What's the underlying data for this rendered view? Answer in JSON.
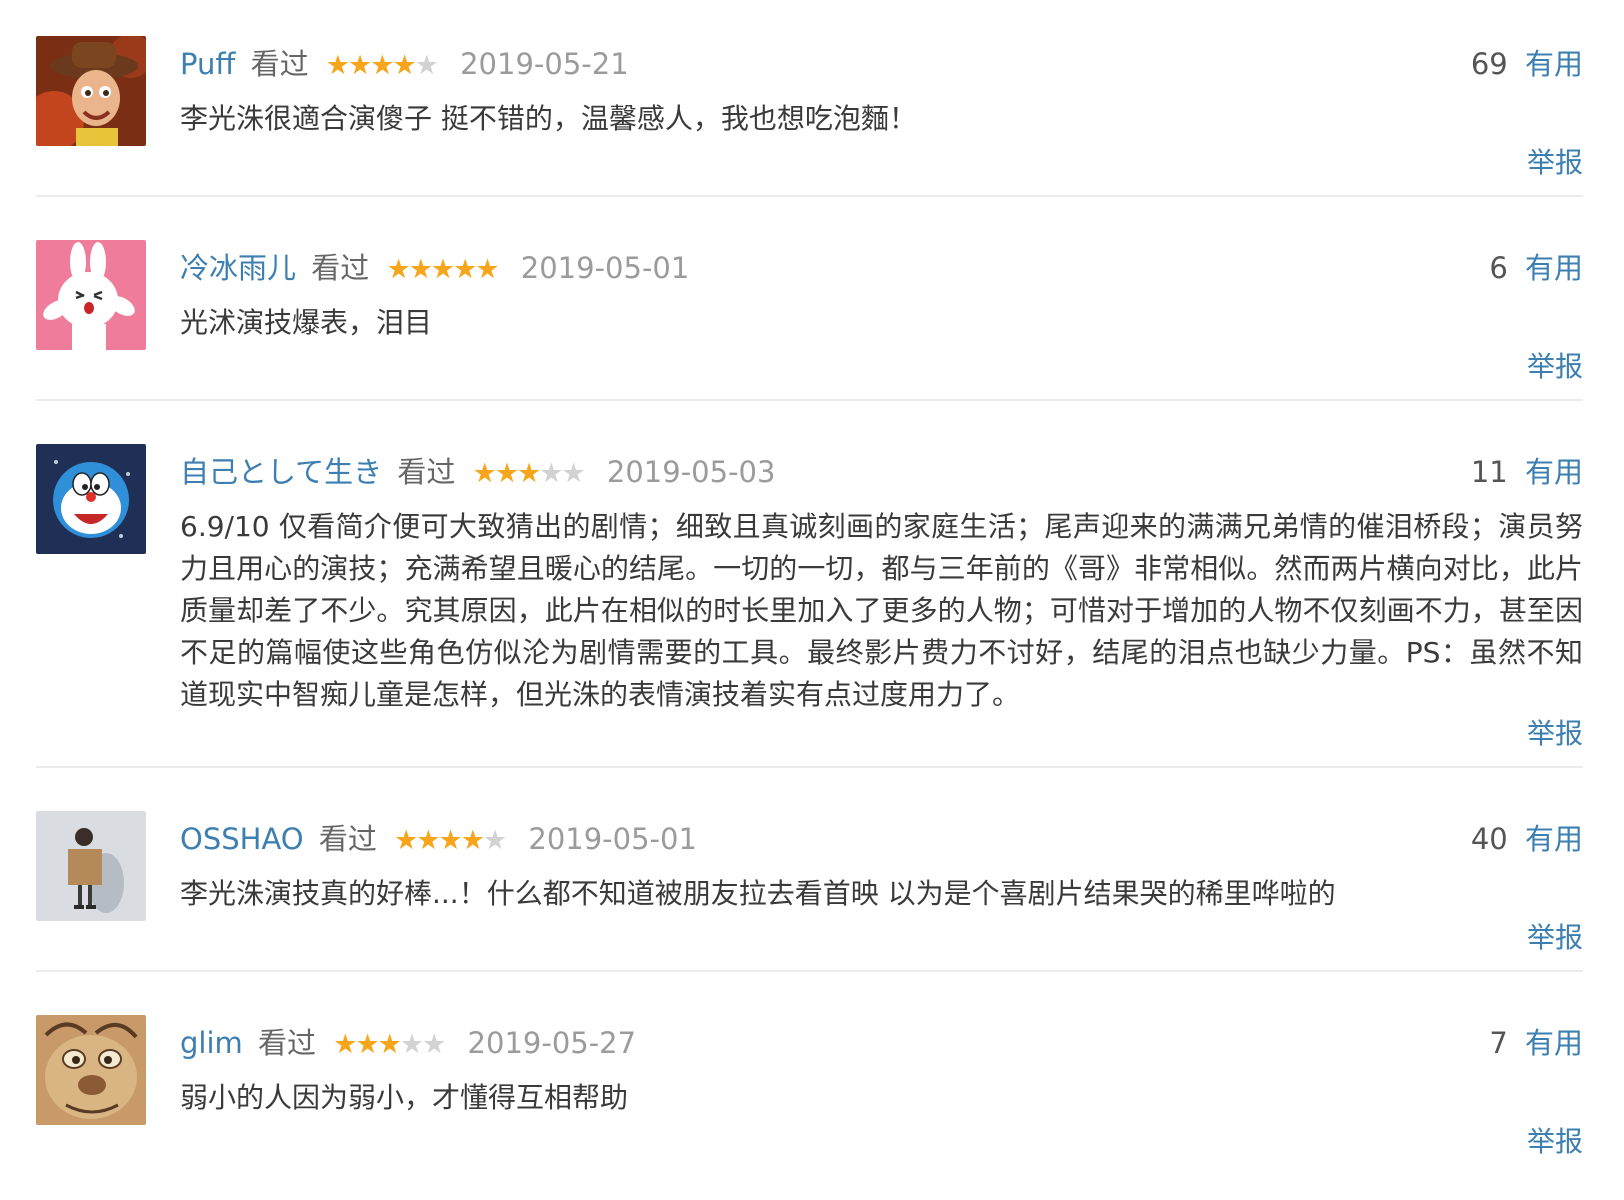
{
  "comments": [
    {
      "user": "Puff",
      "watched": "看过",
      "rating": 4,
      "date": "2019-05-21",
      "votes": "69",
      "useful_label": "有用",
      "text": "李光洙很適合演傻子 挺不错的，温馨感人，我也想吃泡麵！",
      "report_label": "举报",
      "avatar_icon": "woody-cowboy-avatar-icon"
    },
    {
      "user": "冷冰雨儿",
      "watched": "看过",
      "rating": 5,
      "date": "2019-05-01",
      "votes": "6",
      "useful_label": "有用",
      "text": "光沭演技爆表，泪目",
      "report_label": "举报",
      "avatar_icon": "white-bunny-avatar-icon"
    },
    {
      "user": "自己として生き",
      "watched": "看过",
      "rating": 3,
      "date": "2019-05-03",
      "votes": "11",
      "useful_label": "有用",
      "text": "6.9/10 仅看简介便可大致猜出的剧情；细致且真诚刻画的家庭生活；尾声迎来的满满兄弟情的催泪桥段；演员努力且用心的演技；充满希望且暖心的结尾。一切的一切，都与三年前的《哥》非常相似。然而两片横向对比，此片质量却差了不少。究其原因，此片在相似的时长里加入了更多的人物；可惜对于增加的人物不仅刻画不力，甚至因不足的篇幅使这些角色仿似沦为剧情需要的工具。最终影片费力不讨好，结尾的泪点也缺少力量。PS：虽然不知道现实中智痴儿童是怎样，但光洙的表情演技着实有点过度用力了。",
      "report_label": "举报",
      "avatar_icon": "doraemon-avatar-icon"
    },
    {
      "user": "OSSHAO",
      "watched": "看过",
      "rating": 4,
      "date": "2019-05-01",
      "votes": "40",
      "useful_label": "有用",
      "text": "李光洙演技真的好棒...！什么都不知道被朋友拉去看首映 以为是个喜剧片结果哭的稀里哗啦的",
      "report_label": "举报",
      "avatar_icon": "person-with-box-avatar-icon"
    },
    {
      "user": "glim",
      "watched": "看过",
      "rating": 3,
      "date": "2019-05-27",
      "votes": "7",
      "useful_label": "有用",
      "text": "弱小的人因为弱小，才懂得互相帮助",
      "report_label": "举报",
      "avatar_icon": "cartoon-creature-avatar-icon"
    }
  ],
  "colors": {
    "link": "#3c7fb0",
    "star_on": "#f7a51a",
    "star_off": "#d2d2d2",
    "date": "#9b9b9b",
    "text": "#3a3a3a",
    "divider": "#ececec"
  }
}
